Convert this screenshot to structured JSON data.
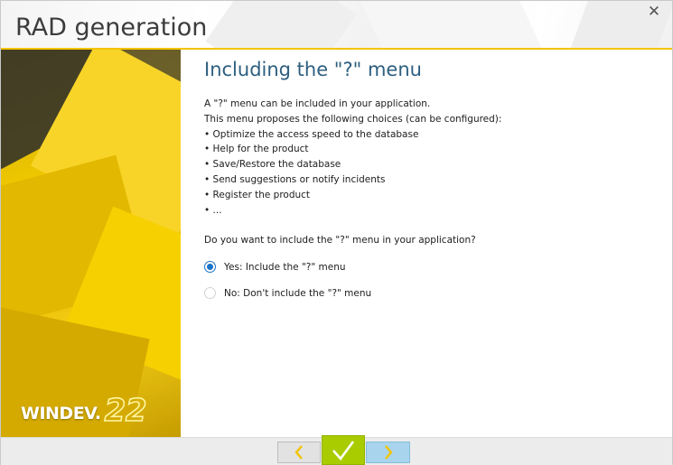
{
  "window": {
    "title": "RAD generation",
    "close_glyph": "✕"
  },
  "logo": {
    "brand": "WINDEV.",
    "version": "22"
  },
  "content": {
    "heading": "Including the \"?\" menu",
    "description_lines": [
      "A \"?\" menu can be included in your application.",
      "This menu proposes the following choices (can be configured):",
      "• Optimize the access speed to the database",
      "• Help for the product",
      "• Save/Restore the database",
      "• Send suggestions or notify incidents",
      "• Register the product",
      "• ..."
    ],
    "question": "Do you want to include the \"?\" menu in your application?",
    "options": [
      {
        "label": "Yes: Include the \"?\" menu",
        "selected": true
      },
      {
        "label": "No: Don't include the \"?\" menu",
        "selected": false
      }
    ]
  },
  "footer": {
    "prev_icon": "chevron-left-icon",
    "ok_icon": "checkmark-icon",
    "next_icon": "chevron-right-icon"
  },
  "colors": {
    "accent_yellow": "#f3c300",
    "heading_blue": "#2d5f80",
    "radio_blue": "#1a73c7",
    "ok_green": "#a9cc00",
    "next_blue": "#a8d4ee"
  }
}
